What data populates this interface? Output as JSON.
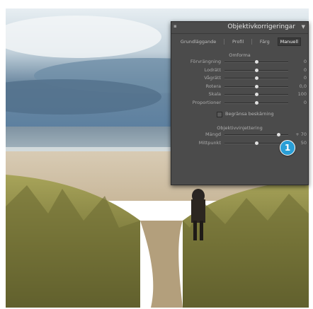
{
  "panel": {
    "title": "Objektivkorrigeringar",
    "tabs": [
      "Grundläggande",
      "Profil",
      "Färg",
      "Manuell"
    ],
    "active_tab": "Manuell",
    "transform_section": "Omforma",
    "transform_rows": [
      {
        "label": "Förvrängning",
        "value": "0",
        "level": 0.5
      },
      {
        "label": "Lodrätt",
        "value": "0",
        "level": 0.5
      },
      {
        "label": "Vågrätt",
        "value": "0",
        "level": 0.5
      },
      {
        "label": "Rotera",
        "value": "0,0",
        "level": 0.5
      },
      {
        "label": "Skala",
        "value": "100",
        "level": 0.5
      },
      {
        "label": "Proportioner",
        "value": "0",
        "level": 0.5
      }
    ],
    "constrain_crop_label": "Begränsa beskärning",
    "vignette_section": "Objektivvinjettering",
    "vignette_rows": [
      {
        "label": "Mängd",
        "value": "+ 70",
        "level": 0.85
      },
      {
        "label": "Mittpunkt",
        "value": "50",
        "level": 0.5
      }
    ]
  },
  "callout": {
    "number": "1",
    "color": "#2a9ed6"
  }
}
